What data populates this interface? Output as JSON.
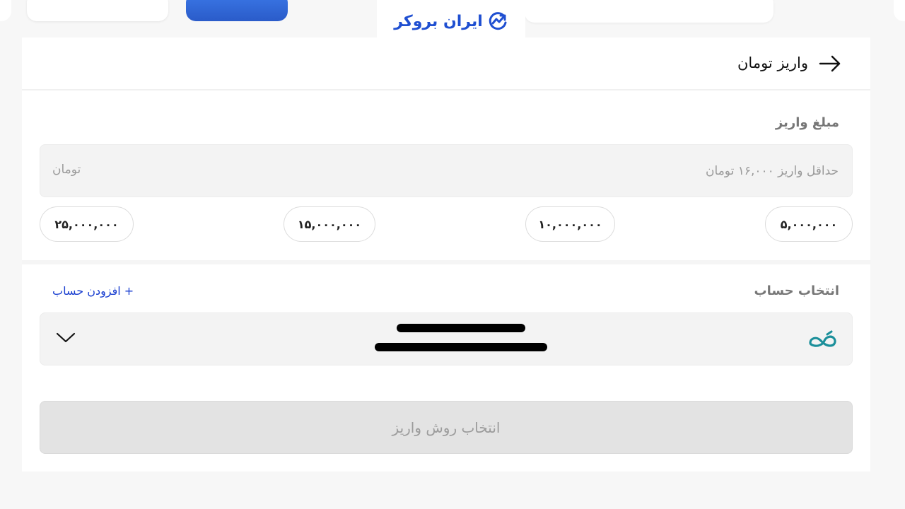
{
  "logo": {
    "text": "ایران بروکر",
    "icon": "chart-up-circle-icon",
    "color": "#1f4fd1"
  },
  "header": {
    "title": "واریز تومان",
    "back_icon": "arrow-right-icon"
  },
  "amount": {
    "label": "مبلغ واریز",
    "placeholder": "حداقل واریز ۱۶,۰۰۰ تومان",
    "value": "",
    "unit": "تومان",
    "presets": [
      "۵,۰۰۰,۰۰۰",
      "۱۰,۰۰۰,۰۰۰",
      "۱۵,۰۰۰,۰۰۰",
      "۲۵,۰۰۰,۰۰۰"
    ]
  },
  "account": {
    "label": "انتخاب حساب",
    "add_label": "+ افزودن حساب",
    "bank_icon": "bank-logo-icon",
    "chevron_icon": "chevron-down-icon",
    "redacted": true
  },
  "submit": {
    "label": "انتخاب روش واریز",
    "enabled": false
  },
  "colors": {
    "accent": "#1a3fd0",
    "bank_teal": "#1b8f9a",
    "disabled_bg": "#e3e3e3"
  }
}
